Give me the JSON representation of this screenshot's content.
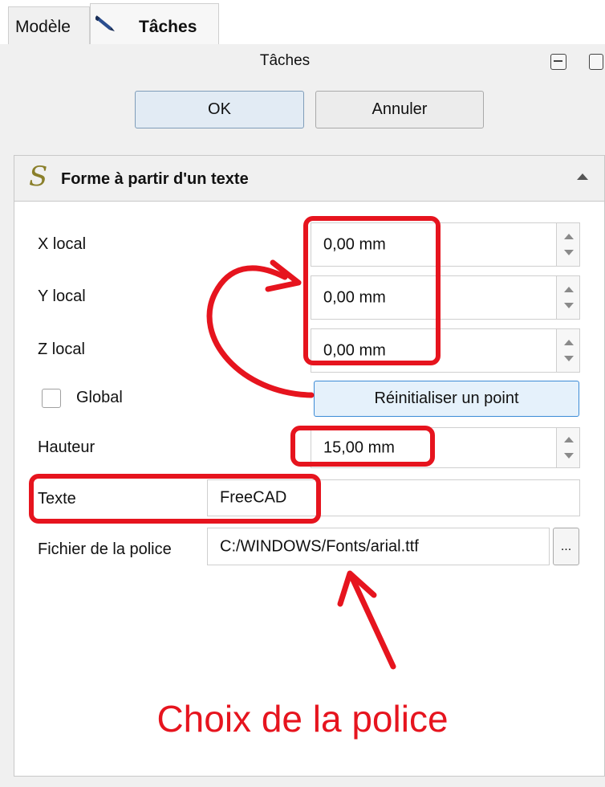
{
  "tabs": {
    "model_label": "Modèle",
    "tasks_label": "Tâches",
    "tasks_icon": "pencil-icon"
  },
  "panel": {
    "title": "Tâches",
    "ok_label": "OK",
    "cancel_label": "Annuler"
  },
  "taskbox": {
    "title": "Forme à partir d'un texte",
    "title_glyph": "S",
    "fields": {
      "x_label": "X local",
      "x_value": "0,00 mm",
      "y_label": "Y local",
      "y_value": "0,00 mm",
      "z_label": "Z local",
      "z_value": "0,00 mm",
      "global_label": "Global",
      "global_checked": false,
      "reset_label": "Réinitialiser un point",
      "height_label": "Hauteur",
      "height_value": "15,00 mm",
      "text_label": "Texte",
      "text_value": "FreeCAD",
      "font_label": "Fichier de la police",
      "font_value": "C:/WINDOWS/Fonts/arial.ttf",
      "browse_label": "..."
    }
  },
  "annotation": {
    "caption": "Choix de la police",
    "color": "#e6141e"
  }
}
